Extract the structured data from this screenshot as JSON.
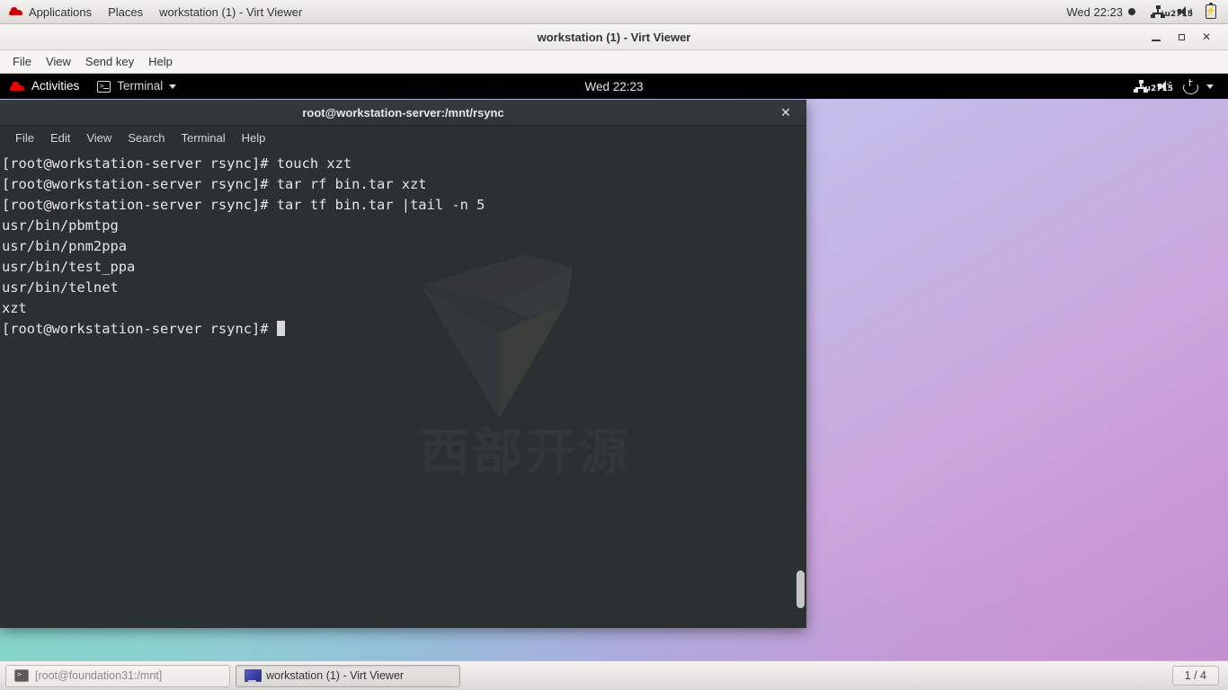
{
  "host_panel": {
    "logo_icon": "redhat-logo",
    "menus": [
      "Applications",
      "Places"
    ],
    "window_title": "workstation (1) - Virt Viewer",
    "clock": "Wed 22:23",
    "recording_dot": "●",
    "tray_icons": [
      "network-icon",
      "speaker-muted-icon",
      "battery-charging-icon"
    ],
    "battery_bolt": "⚡"
  },
  "virt_viewer": {
    "title": "workstation (1) - Virt Viewer",
    "menus": [
      "File",
      "View",
      "Send key",
      "Help"
    ],
    "controls": {
      "minimize": "–",
      "maximize": "□",
      "close": "✕"
    }
  },
  "gnome_bar": {
    "activities": "Activities",
    "app_name": "Terminal",
    "app_icon": "terminal-icon",
    "caret": "▾",
    "clock": "Wed 22:23",
    "tray_icons": [
      "network-icon",
      "speaker-muted-icon",
      "power-icon",
      "chevron-down-icon"
    ]
  },
  "terminal": {
    "title": "root@workstation-server:/mnt/rsync",
    "close_label": "✕",
    "menus": [
      "File",
      "Edit",
      "View",
      "Search",
      "Terminal",
      "Help"
    ],
    "lines": [
      "[root@workstation-server rsync]# touch xzt",
      "[root@workstation-server rsync]# tar rf bin.tar xzt",
      "[root@workstation-server rsync]# tar tf bin.tar |tail -n 5",
      "usr/bin/pbmtpg",
      "usr/bin/pnm2ppa",
      "usr/bin/test_ppa",
      "usr/bin/telnet",
      "xzt"
    ],
    "prompt": "[root@workstation-server rsync]# ",
    "colors": {
      "background": "#2b3033",
      "foreground": "#e6e6e6"
    }
  },
  "watermark": {
    "text": "西部开源",
    "logo_icon": "angular-arrow-logo"
  },
  "taskbar": {
    "items": [
      {
        "label": "[root@foundation31:/mnt]",
        "icon": "terminal-icon",
        "active": false
      },
      {
        "label": "workstation (1) - Virt Viewer",
        "icon": "display-icon",
        "active": true
      }
    ],
    "workspace": "1 / 4"
  },
  "theme": {
    "panel_bg": "#ebe9e7",
    "gnome_bar_bg": "#000000",
    "terminal_bg": "#2b3033",
    "accent_red": "#cc0000",
    "wallpaper_top": "#cfd6f7",
    "wallpaper_bottom": "#c48fd0"
  }
}
